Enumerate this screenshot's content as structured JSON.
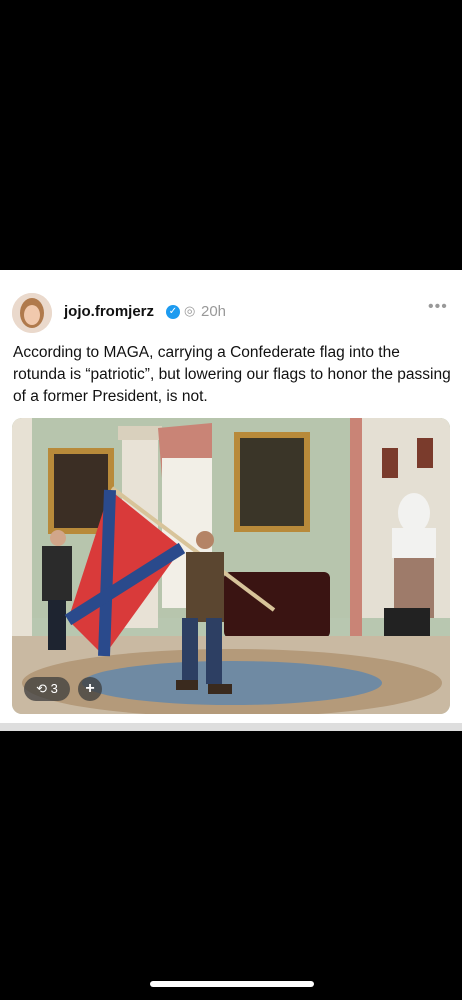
{
  "post": {
    "username": "jojo.fromjerz",
    "time": "20h",
    "text": "According to MAGA, carrying a Confederate flag into the rotunda is “patriotic”, but lowering our flags to honor the passing of a former President, is not.",
    "repost_count": "3",
    "more_label": "•••",
    "plus_label": "+"
  },
  "icons": {
    "verified": "verified-check-icon",
    "visibility": "globe-icon",
    "repost": "repost-icon"
  },
  "colors": {
    "background": "#000000",
    "card": "#ffffff",
    "verified": "#1d9bf0"
  }
}
